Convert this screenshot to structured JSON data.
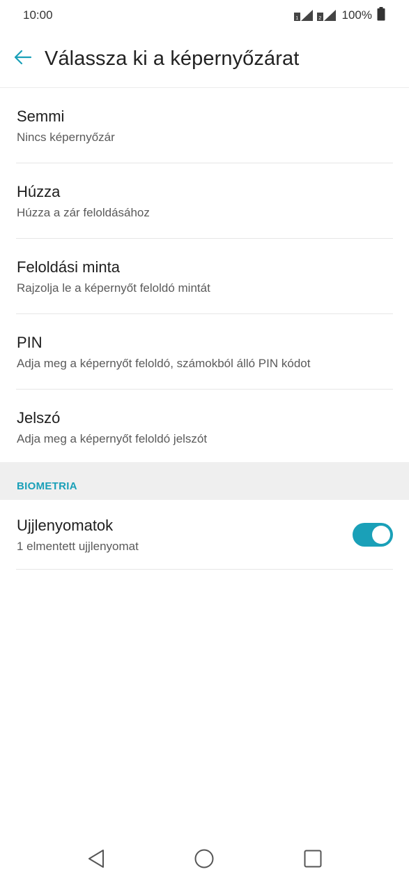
{
  "status_bar": {
    "time": "10:00",
    "battery_percent": "100%",
    "icons": [
      "sim1-signal-icon",
      "sim2-signal-icon",
      "battery-icon"
    ]
  },
  "app_bar": {
    "title": "Válassza ki a képernyőzárat",
    "back_icon": "back-arrow-icon"
  },
  "options": [
    {
      "title": "Semmi",
      "subtitle": "Nincs képernyőzár"
    },
    {
      "title": "Húzza",
      "subtitle": "Húzza a zár feloldásához"
    },
    {
      "title": "Feloldási minta",
      "subtitle": "Rajzolja le a képernyőt feloldó mintát"
    },
    {
      "title": "PIN",
      "subtitle": "Adja meg a képernyőt feloldó, számokból álló PIN kódot"
    },
    {
      "title": "Jelszó",
      "subtitle": "Adja meg a képernyőt feloldó jelszót"
    }
  ],
  "biometrics": {
    "section_label": "BIOMETRIA",
    "fingerprint": {
      "title": "Ujjlenyomatok",
      "subtitle": "1 elmentett ujjlenyomat",
      "toggle_on": true
    }
  },
  "nav_bar": {
    "icons": [
      "back-triangle-icon",
      "home-circle-icon",
      "recents-square-icon"
    ]
  },
  "colors": {
    "accent": "#1aa0b8",
    "section_bg": "#efefef",
    "divider": "#e6e6e6"
  }
}
